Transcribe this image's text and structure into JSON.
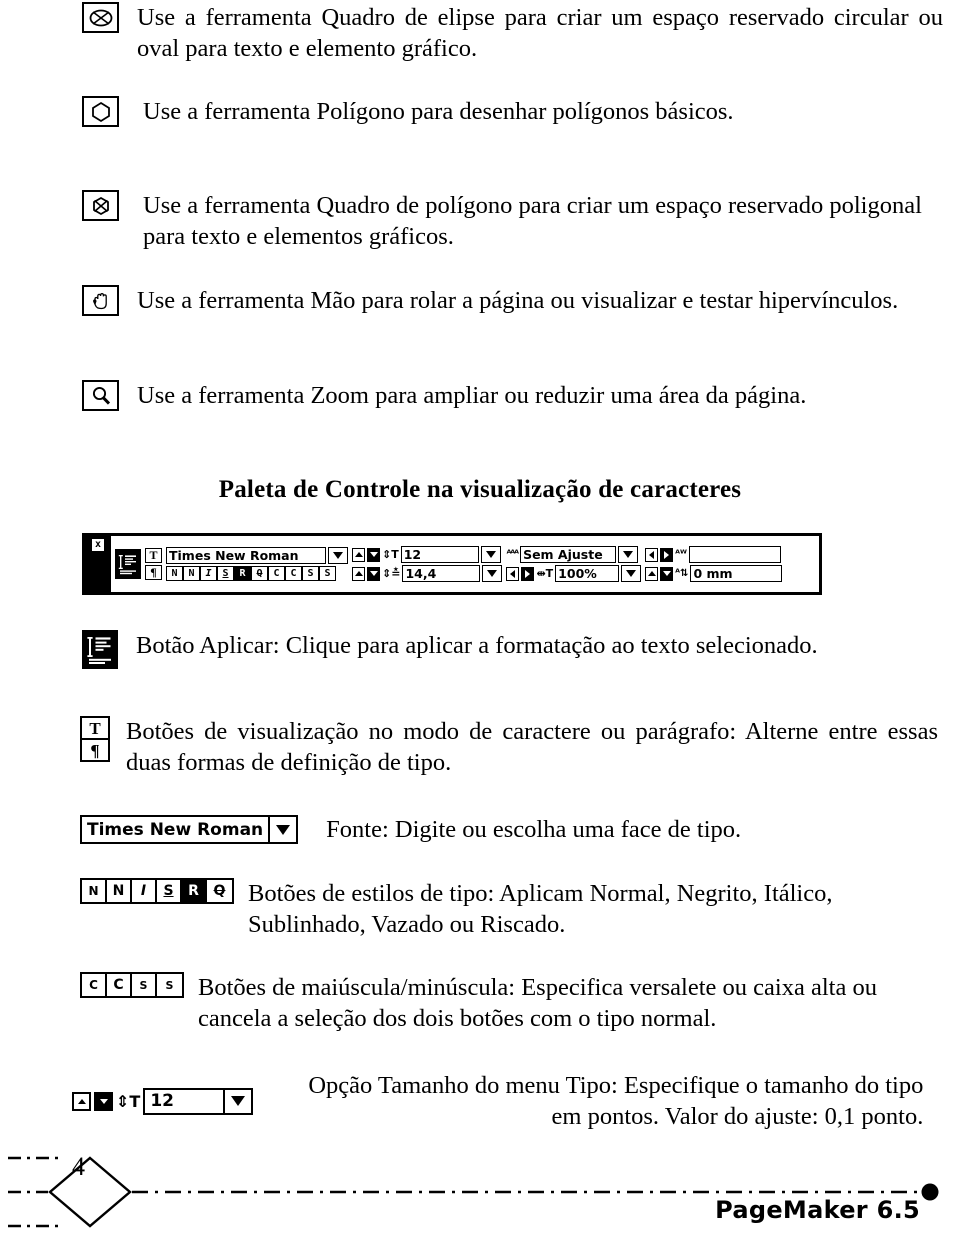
{
  "document": {
    "page_number": "4",
    "footer_label": "PageMaker 6.5"
  },
  "tool_entries": [
    {
      "icon": "ellipse-frame-tool-icon",
      "text": "Use a ferramenta Quadro de elipse para criar um espaço reservado circular ou oval para texto e elemento gráfico."
    },
    {
      "icon": "polygon-tool-icon",
      "text": "Use a ferramenta Polígono para desenhar polígonos básicos."
    },
    {
      "icon": "polygon-frame-tool-icon",
      "text": "Use a ferramenta Quadro de polígono para criar um espaço reservado poligonal para texto e elementos gráficos."
    },
    {
      "icon": "hand-tool-icon",
      "text": "Use a ferramenta Mão para rolar a página ou visualizar e testar hipervínculos."
    },
    {
      "icon": "zoom-tool-icon",
      "text": "Use a ferramenta Zoom para ampliar ou reduzir uma área da página."
    }
  ],
  "section": {
    "heading": "Paleta de Controle na visualização de caracteres"
  },
  "control_palette": {
    "close_glyph": "x",
    "view_character_label": "T",
    "view_paragraph_label": "¶",
    "font_name": "Times New Roman",
    "style_buttons": [
      "N",
      "N",
      "I",
      "S",
      "R",
      "Q"
    ],
    "case_buttons": [
      "C",
      "C",
      "S",
      "S"
    ],
    "type_size": "12",
    "leading": "14,4",
    "tracking": "Sem Ajuste",
    "horizontal_scale": "100%",
    "kerning": "",
    "baseline_shift": "0 mm"
  },
  "descriptions": [
    {
      "widget": "apply-button-icon",
      "text": "Botão Aplicar: Clique para aplicar a formatação ao texto selecionado."
    },
    {
      "widget": "view-mode-buttons-icon",
      "text": "Botões de visualização no modo de caractere ou parágrafo: Alterne entre essas duas formas de definição de tipo."
    },
    {
      "widget": "font-dropdown",
      "value": "Times New Roman",
      "text": "Fonte: Digite ou escolha uma face de tipo."
    },
    {
      "widget": "type-style-buttons",
      "buttons": [
        "N",
        "N",
        "I",
        "S",
        "R",
        "Q"
      ],
      "text": "Botões de estilos de tipo: Aplicam Normal, Negrito, Itálico, Sublinhado, Vazado ou Riscado."
    },
    {
      "widget": "case-buttons",
      "buttons": [
        "C",
        "C",
        "S",
        "S"
      ],
      "text": "Botões de maiúscula/minúscula: Especifica versalete ou caixa alta ou cancela a seleção dos dois botões com o tipo normal."
    },
    {
      "widget": "type-size-field",
      "value": "12",
      "text": "Opção Tamanho do menu Tipo: Especifique o tamanho do tipo em pontos. Valor do ajuste: 0,1 ponto."
    }
  ],
  "colors": {
    "ink": "#000000",
    "paper": "#ffffff"
  }
}
